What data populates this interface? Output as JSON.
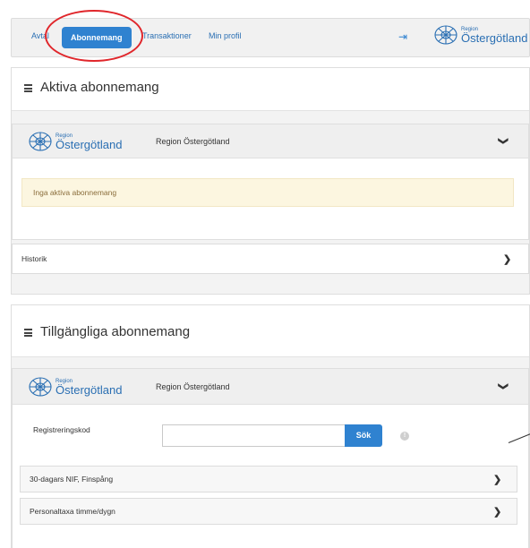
{
  "nav": {
    "items": [
      {
        "label": "Avtal"
      },
      {
        "label": "Abonnemang"
      },
      {
        "label": "Transaktioner"
      },
      {
        "label": "Min profil"
      }
    ],
    "logout_icon": "logout-icon"
  },
  "logo": {
    "small": "Region",
    "big": "Östergötland"
  },
  "active_panel": {
    "title": "Aktiva abonnemang",
    "org_name": "Region Östergötland",
    "alert": "Inga aktiva abonnemang",
    "history_label": "Historik"
  },
  "available_panel": {
    "title": "Tillgängliga abonnemang",
    "org_name": "Region Östergötland",
    "reg_label": "Registreringskod",
    "reg_placeholder": "",
    "search_label": "Sök",
    "info_glyph": "!",
    "items": [
      {
        "label": "30-dagars NIF, Finspång"
      },
      {
        "label": "Personaltaxa timme/dygn"
      }
    ]
  },
  "icons": {
    "chevron_down": "❯",
    "chevron_right": "❯",
    "logout": "⇥"
  },
  "colors": {
    "accent": "#2f82d0",
    "highlight": "#e0262b",
    "alert_bg": "#fcf6e0"
  }
}
